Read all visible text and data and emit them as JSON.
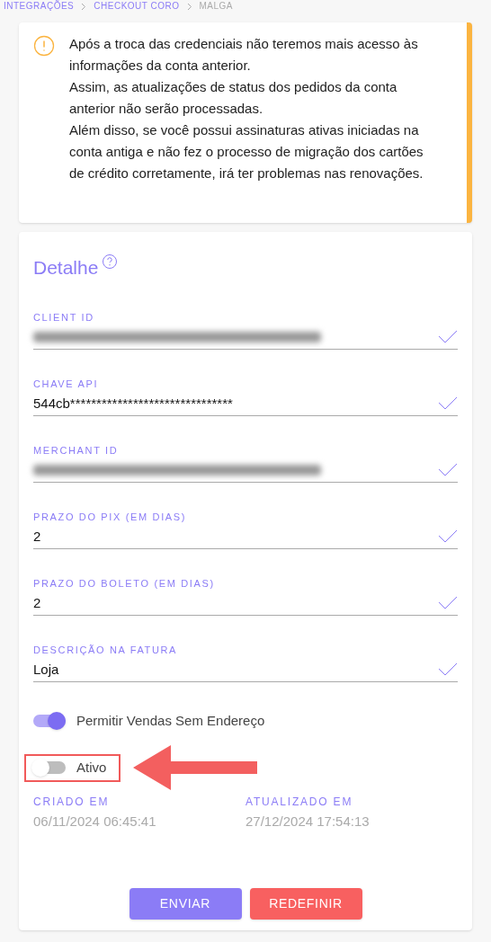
{
  "breadcrumb": [
    {
      "label": "INTEGRAÇÕES",
      "selected": false
    },
    {
      "label": "CHECKOUT CORO",
      "selected": false
    },
    {
      "label": "MALGA",
      "selected": true
    }
  ],
  "alert": {
    "lines": [
      "Após a troca das credenciais não teremos mais acesso às informações da conta anterior.",
      "Assim, as atualizações de status dos pedidos da conta anterior não serão processadas.",
      "Além disso, se você possui assinaturas ativas iniciadas na conta antiga e não fez o processo de migração dos cartões de crédito corretamente, irá ter problemas nas renovações."
    ]
  },
  "form": {
    "title": "Detalhe",
    "fields": [
      {
        "label": "CLIENT ID",
        "kind": "redacted",
        "valid": true
      },
      {
        "label": "CHAVE API",
        "kind": "text",
        "value": "544cb*******************************",
        "valid": true
      },
      {
        "label": "MERCHANT ID",
        "kind": "redacted",
        "valid": true
      },
      {
        "label": "PRAZO DO PIX (EM DIAS)",
        "kind": "text",
        "value": "2",
        "valid": true
      },
      {
        "label": "PRAZO DO BOLETO (EM DIAS)",
        "kind": "text",
        "value": "2",
        "valid": true
      },
      {
        "label": "DESCRIÇÃO NA FATURA",
        "kind": "text",
        "value": "Loja",
        "valid": true
      }
    ],
    "toggles": [
      {
        "label": "Permitir Vendas Sem Endereço",
        "on": true,
        "highlighted": false
      },
      {
        "label": "Ativo",
        "on": false,
        "highlighted": true
      }
    ],
    "dates": [
      {
        "label": "CRIADO EM",
        "value": "06/11/2024 06:45:41"
      },
      {
        "label": "ATUALIZADO EM",
        "value": "27/12/2024 17:54:13"
      }
    ],
    "buttons": [
      {
        "label": "ENVIAR",
        "kind": "primary"
      },
      {
        "label": "REDEFINIR",
        "kind": "danger"
      }
    ]
  }
}
